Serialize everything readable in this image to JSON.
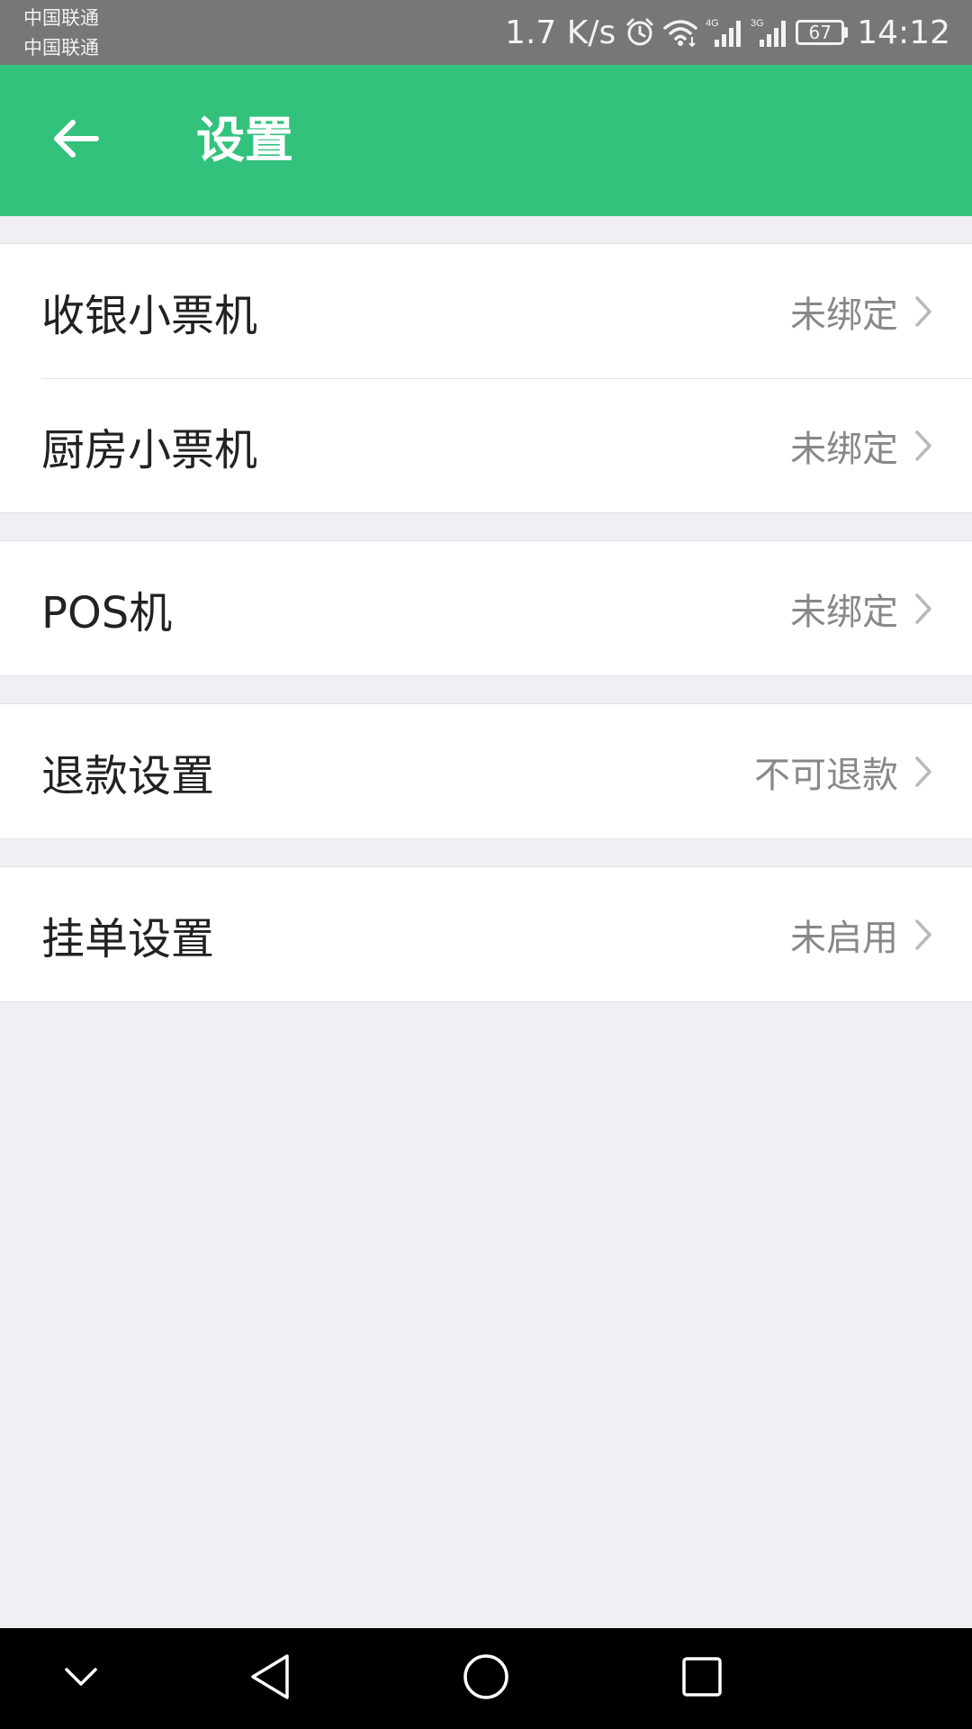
{
  "status_bar": {
    "carrier_1": "中国联通",
    "carrier_2": "中国联通",
    "net_speed": "1.7 K/s",
    "battery": "67",
    "time": "14:12",
    "signal_1_label": "4G",
    "signal_2_label": "3G",
    "icons": [
      "alarm-icon",
      "wifi-icon",
      "signal-4g-icon",
      "signal-3g-icon",
      "battery-icon"
    ]
  },
  "app_bar": {
    "title": "设置",
    "back_icon": "arrow-left-icon",
    "background": "#33c27c"
  },
  "settings": {
    "groups": [
      {
        "items": [
          {
            "label": "收银小票机",
            "value": "未绑定"
          },
          {
            "label": "厨房小票机",
            "value": "未绑定"
          }
        ]
      },
      {
        "items": [
          {
            "label": "POS机",
            "value": "未绑定"
          }
        ]
      },
      {
        "items": [
          {
            "label": "退款设置",
            "value": "不可退款"
          }
        ]
      },
      {
        "items": [
          {
            "label": "挂单设置",
            "value": "未启用"
          }
        ]
      }
    ]
  },
  "nav_bar": {
    "icons": [
      "chevron-down-icon",
      "back-triangle-icon",
      "home-circle-icon",
      "recents-square-icon"
    ]
  },
  "colors": {
    "accent": "#33c27c",
    "page_background": "#efeff4",
    "status_bar": "#777777",
    "label_text": "#222222",
    "value_text": "#888888"
  }
}
